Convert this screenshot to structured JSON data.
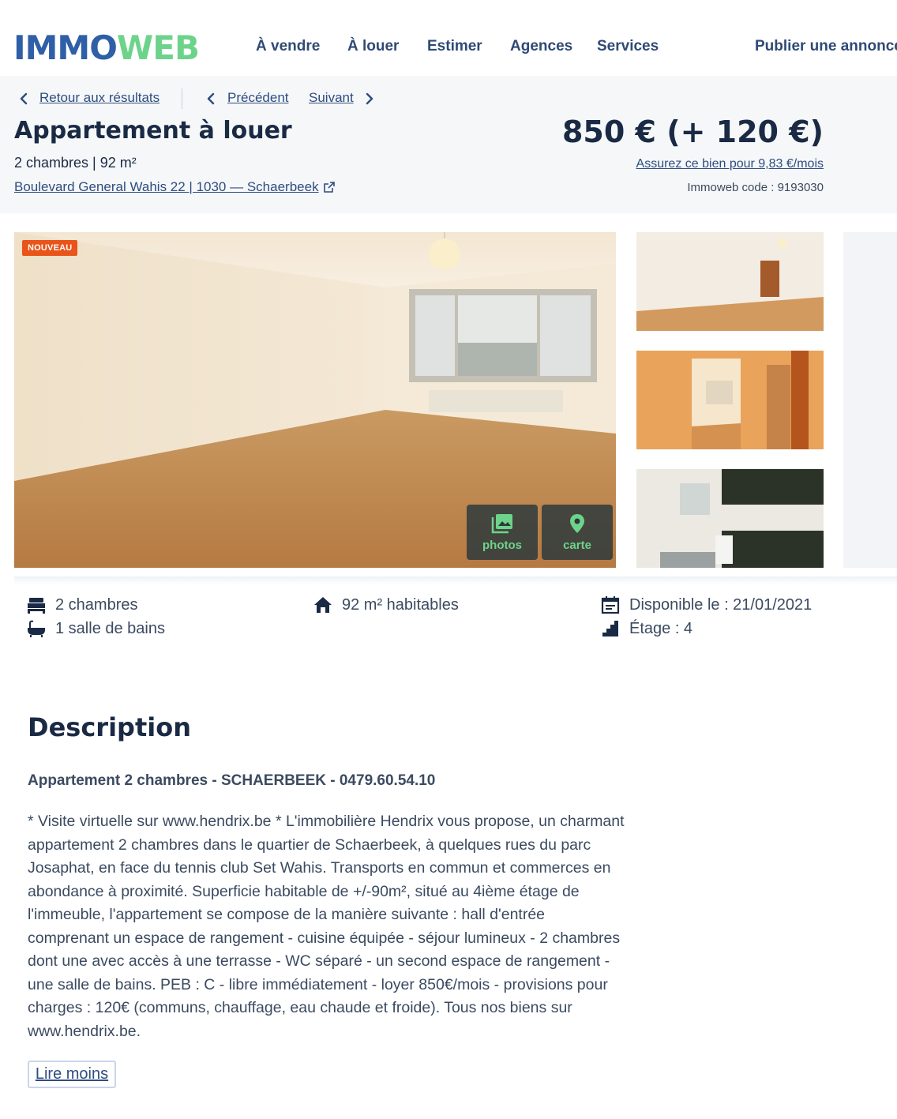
{
  "brand": {
    "logo_part1": "IMMO",
    "logo_part2": "WEB"
  },
  "nav": {
    "items": [
      "À vendre",
      "À louer",
      "Estimer",
      "Agences",
      "Services"
    ],
    "publish": "Publier une annonce"
  },
  "breadcrumb": {
    "back": "Retour aux résultats",
    "previous": "Précédent",
    "next": "Suivant"
  },
  "listing": {
    "title": "Appartement à louer",
    "subtitle": "2 chambres | 92 m²",
    "address": "Boulevard General Wahis 22 | 1030 — Schaerbeek",
    "price": "850 € (+ 120 €)",
    "insure": "Assurez ce bien pour 9,83 €/mois",
    "code": "Immoweb code : 9193030"
  },
  "gallery": {
    "badge": "NOUVEAU",
    "photos_label": "photos",
    "map_label": "carte"
  },
  "features": {
    "bedrooms": "2 chambres",
    "bathrooms": "1 salle de bains",
    "surface": "92 m² habitables",
    "available": "Disponible le : 21/01/2021",
    "floor": "Étage : 4"
  },
  "description": {
    "heading": "Description",
    "subheading": "Appartement 2 chambres - SCHAERBEEK - 0479.60.54.10",
    "body": "* Visite virtuelle sur www.hendrix.be * L'immobilière Hendrix vous propose, un charmant appartement 2 chambres dans le quartier de Schaerbeek, à quelques rues du parc Josaphat, en face du tennis club Set Wahis. Transports en commun et commerces en abondance à proximité. Superficie habitable de +/-90m², situé au 4ième étage de l'immeuble, l'appartement se compose de la manière suivante : hall d'entrée comprenant un espace de rangement - cuisine équipée - séjour lumineux - 2 chambres dont une avec accès à une terrasse - WC séparé - un second espace de rangement - une salle de bains. PEB : C - libre immédiatement - loyer 850€/mois - provisions pour charges : 120€ (communs, chauffage, eau chaude et froide). Tous nos biens sur www.hendrix.be.",
    "toggle": "Lire moins"
  },
  "colors": {
    "brand_blue": "#2f5fa7",
    "brand_green": "#6ed38a",
    "badge_orange": "#e8541a",
    "link_blue": "#2e4d7f"
  }
}
